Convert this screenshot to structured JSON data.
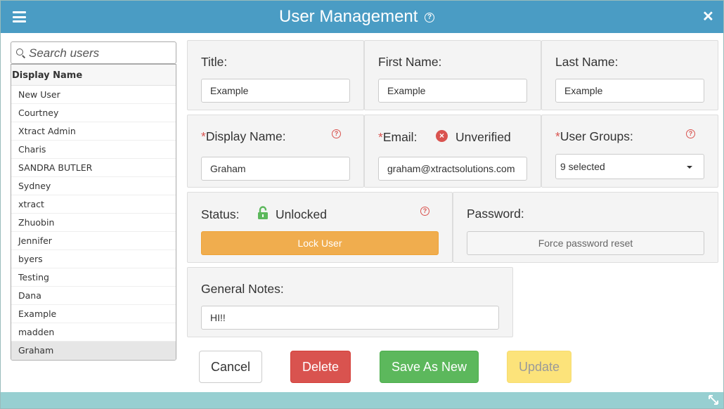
{
  "window": {
    "title": "User Management"
  },
  "sidebar": {
    "search_placeholder": "Search users",
    "list_header": "Display Name",
    "users": [
      "New User",
      "Courtney",
      "Xtract Admin",
      "Charis",
      "SANDRA BUTLER",
      "Sydney",
      "xtract",
      "Zhuobin",
      "Jennifer",
      "byers",
      "Testing",
      "Dana",
      "Example",
      "madden",
      "Graham"
    ],
    "selected_user": "Graham"
  },
  "form": {
    "title": {
      "label": "Title:",
      "value": "Example"
    },
    "first_name": {
      "label": "First Name:",
      "value": "Example"
    },
    "last_name": {
      "label": "Last Name:",
      "value": "Example"
    },
    "display_name": {
      "required_mark": "*",
      "label": "Display Name:",
      "value": "Graham"
    },
    "email": {
      "required_mark": "*",
      "label": "Email:",
      "verification_status": "Unverified",
      "value": "graham@xtractsolutions.com"
    },
    "user_groups": {
      "required_mark": "*",
      "label": "User Groups:",
      "value": "9 selected"
    },
    "status": {
      "label": "Status:",
      "value": "Unlocked",
      "button": "Lock User"
    },
    "password": {
      "label": "Password:",
      "button": "Force password reset"
    },
    "general_notes": {
      "label": "General Notes:",
      "value": "HI!!"
    }
  },
  "actions": {
    "cancel": "Cancel",
    "delete": "Delete",
    "save_as_new": "Save As New",
    "update": "Update"
  },
  "colors": {
    "header": "#4a9cc4",
    "footer": "#97cfd1",
    "lock_button": "#f0ad4e",
    "delete": "#d9534f",
    "save": "#5cb85c",
    "update": "#fce37a",
    "required": "#d9534f",
    "unlocked_icon": "#5cb85c"
  }
}
